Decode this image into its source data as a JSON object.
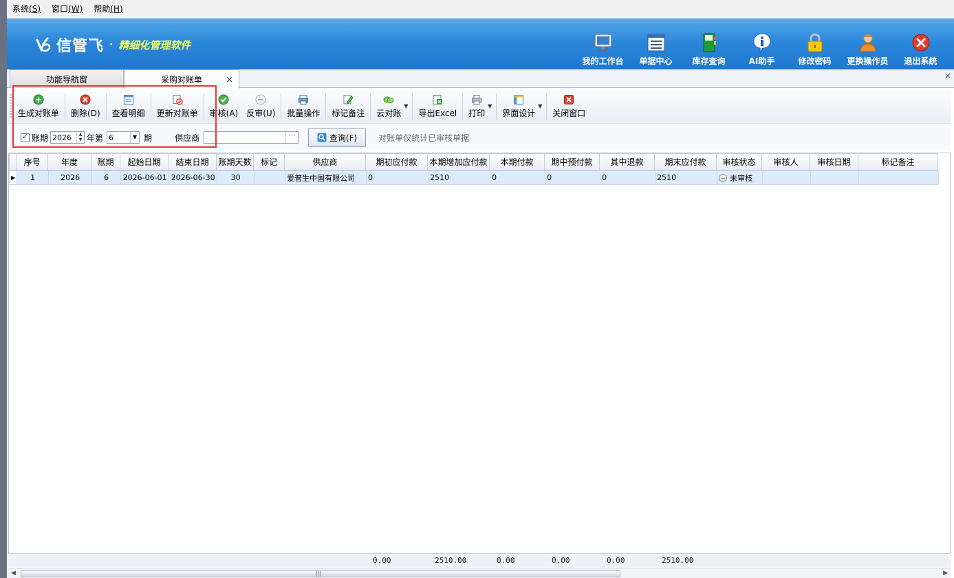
{
  "menu": [
    {
      "label": "系统",
      "key": "(S)"
    },
    {
      "label": "窗口",
      "key": "(W)"
    },
    {
      "label": "帮助",
      "key": "(H)"
    }
  ],
  "banner": {
    "brand": "信管飞",
    "separator": "·",
    "slogan": "精细化管理软件",
    "quick": [
      {
        "label": "我的工作台",
        "icon": "monitor-icon"
      },
      {
        "label": "单据中心",
        "icon": "document-list-icon"
      },
      {
        "label": "库存查询",
        "icon": "book-icon"
      },
      {
        "label": "AI助手",
        "icon": "info-icon"
      },
      {
        "label": "修改密码",
        "icon": "lock-icon"
      },
      {
        "label": "更换操作员",
        "icon": "user-icon"
      },
      {
        "label": "退出系统",
        "icon": "exit-icon"
      }
    ]
  },
  "tabs": {
    "nav": "功能导航窗",
    "current": "采购对账单",
    "close": "×",
    "panel_close": "×"
  },
  "toolbar": [
    {
      "label": "生成对账单",
      "icon": "add-circle-icon"
    },
    {
      "label": "删除(D)",
      "icon": "delete-circle-icon"
    },
    {
      "label": "查看明细",
      "icon": "detail-form-icon"
    },
    {
      "label": "更新对账单",
      "icon": "update-doc-icon"
    },
    {
      "label": "审核(A)",
      "icon": "approve-check-icon"
    },
    {
      "label": "反审(U)",
      "icon": "unapprove-icon"
    },
    {
      "label": "批量操作",
      "icon": "batch-printer-icon"
    },
    {
      "label": "标记备注",
      "icon": "edit-note-icon"
    },
    {
      "label": "云对账",
      "icon": "cloud-icon"
    },
    {
      "label": "导出Excel",
      "icon": "excel-export-icon"
    },
    {
      "label": "打印",
      "icon": "printer-icon"
    },
    {
      "label": "界面设计",
      "icon": "layout-design-icon"
    },
    {
      "label": "关闭窗口",
      "icon": "close-window-icon"
    }
  ],
  "filter": {
    "checkbox_label": "账期",
    "checked": true,
    "year": "2026",
    "year_label": "年第",
    "period": "6",
    "period_label": "期",
    "supplier_label": "供应商",
    "supplier_value": "",
    "supplier_btn": "···",
    "query_label": "查询(F)",
    "note": "对账单仅统计已审核单据"
  },
  "table": {
    "columns": [
      "序号",
      "年度",
      "账期",
      "起始日期",
      "结束日期",
      "账期天数",
      "标记",
      "供应商",
      "期初应付款",
      "本期增加应付款",
      "本期付款",
      "期中预付款",
      "其中退款",
      "期末应付款",
      "审核状态",
      "审核人",
      "审核日期",
      "标记备注"
    ],
    "rows": [
      [
        "1",
        "2026",
        "6",
        "2026-06-01",
        "2026-06-30",
        "30",
        "",
        "爱普生中国有限公司",
        "0",
        "2510",
        "0",
        "0",
        "0",
        "2510",
        "未审核",
        "",
        "",
        ""
      ]
    ],
    "totals": {
      "opening": "0.00",
      "increase": "2510.00",
      "paid": "0.00",
      "prepaid": "0.00",
      "refund": "0.00",
      "closing": "2510.00"
    }
  },
  "colors": {
    "banner_top": "#58a9ea",
    "banner_bottom": "#1f77cf",
    "slogan": "#f1ff66",
    "highlight": "#e33333",
    "row_selected": "#dcebfa"
  }
}
